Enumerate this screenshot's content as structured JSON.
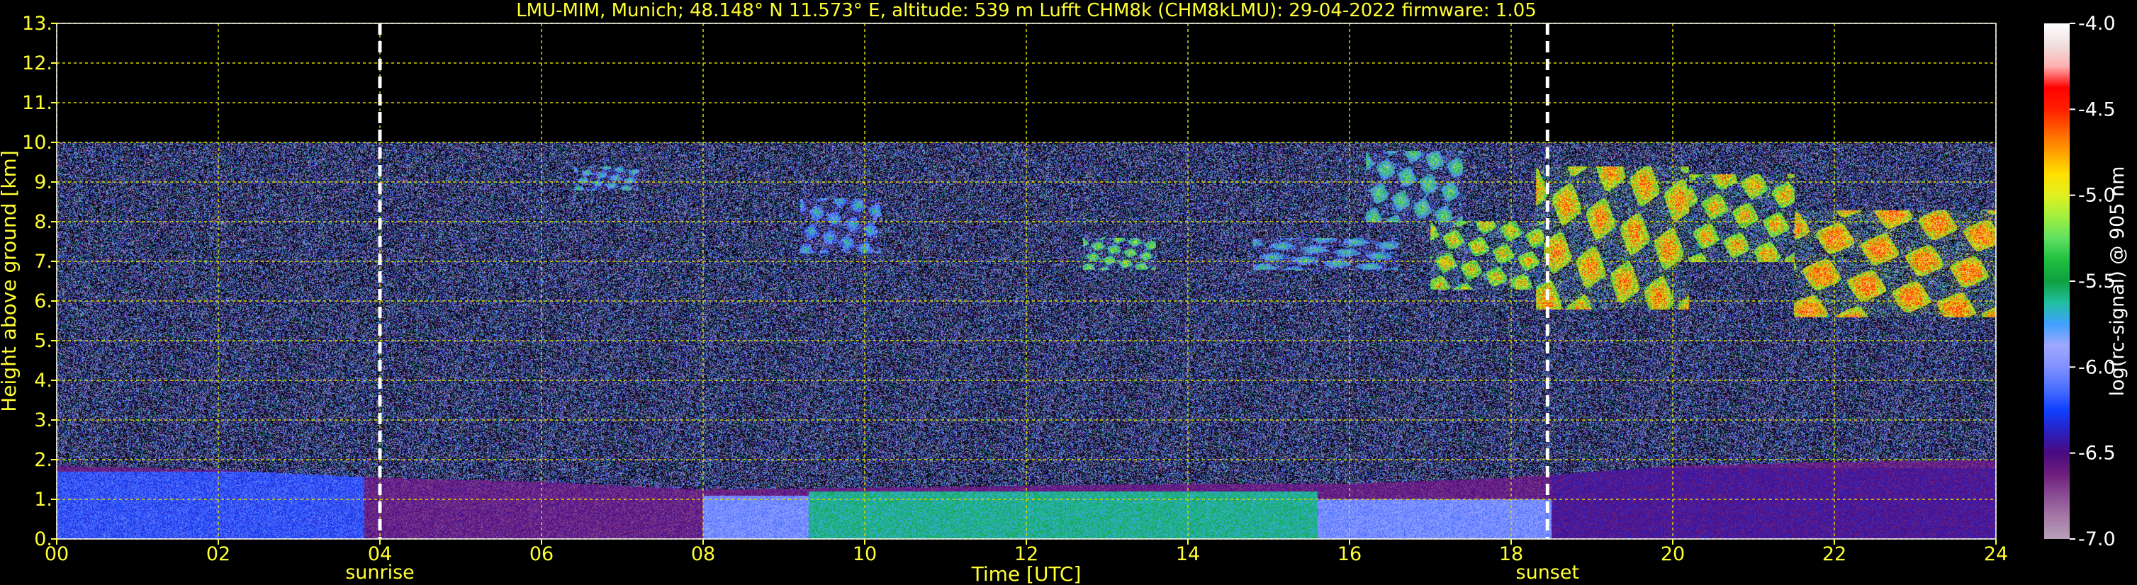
{
  "chart_data": {
    "type": "heatmap",
    "title": "LMU-MIM, Munich; 48.148° N 11.573° E, altitude: 539 m    Lufft CHM8k (CHM8kLMU): 29-04-2022    firmware: 1.05",
    "xlabel": "Time [UTC]",
    "ylabel": "Height above ground [km]",
    "xlim": [
      0,
      24
    ],
    "ylim": [
      0,
      13
    ],
    "x_ticks": [
      "00",
      "02",
      "04",
      "06",
      "08",
      "10",
      "12",
      "14",
      "16",
      "18",
      "20",
      "22",
      "24"
    ],
    "y_ticks": [
      "0.",
      "1.",
      "2.",
      "3.",
      "4.",
      "5.",
      "6.",
      "7.",
      "8.",
      "9.",
      "10.",
      "11.",
      "12.",
      "13."
    ],
    "grid": true,
    "colorbar": {
      "label": "log(rc-signal) @ 905 nm",
      "range": [
        -7.0,
        -4.0
      ],
      "ticks": [
        "-4.0",
        "-4.5",
        "-5.0",
        "-5.5",
        "-6.0",
        "-6.5",
        "-7.0"
      ],
      "colors": [
        "#b8a0b8",
        "#a77aa8",
        "#8a4e94",
        "#6e1f7e",
        "#4a0a80",
        "#2a20c0",
        "#1040ff",
        "#4a70ff",
        "#8090ff",
        "#a0a8ff",
        "#40a0ff",
        "#20c0a0",
        "#10a040",
        "#20c040",
        "#60e060",
        "#a0f040",
        "#e0f020",
        "#ffe000",
        "#ffa000",
        "#ff6000",
        "#ff2000",
        "#ff0000",
        "#ffb0b0",
        "#f0e0e0",
        "#ffffff"
      ]
    },
    "measurement_ceiling_km": 10,
    "events": [
      {
        "label": "sunrise",
        "time": 4.0
      },
      {
        "label": "sunset",
        "time": 18.45
      }
    ],
    "boundary_layer_top_km": [
      {
        "t": 0,
        "h": 1.85
      },
      {
        "t": 2,
        "h": 1.75
      },
      {
        "t": 4,
        "h": 1.55
      },
      {
        "t": 6,
        "h": 1.45
      },
      {
        "t": 8,
        "h": 1.25
      },
      {
        "t": 10,
        "h": 1.3
      },
      {
        "t": 12,
        "h": 1.35
      },
      {
        "t": 14,
        "h": 1.4
      },
      {
        "t": 16,
        "h": 1.4
      },
      {
        "t": 18,
        "h": 1.55
      },
      {
        "t": 20,
        "h": 1.85
      },
      {
        "t": 22,
        "h": 1.95
      },
      {
        "t": 24,
        "h": 2.0
      }
    ],
    "cloud_layers": [
      {
        "t_start": 6.4,
        "t_end": 7.2,
        "h_bottom": 8.8,
        "h_top": 9.4,
        "value": -5.6
      },
      {
        "t_start": 9.2,
        "t_end": 10.2,
        "h_bottom": 7.2,
        "h_top": 8.6,
        "value": -5.7
      },
      {
        "t_start": 12.7,
        "t_end": 13.6,
        "h_bottom": 6.8,
        "h_top": 7.6,
        "value": -5.2
      },
      {
        "t_start": 14.8,
        "t_end": 16.6,
        "h_bottom": 6.8,
        "h_top": 7.6,
        "value": -5.6
      },
      {
        "t_start": 16.2,
        "t_end": 17.4,
        "h_bottom": 8.0,
        "h_top": 9.8,
        "value": -5.4
      },
      {
        "t_start": 17.0,
        "t_end": 18.4,
        "h_bottom": 6.3,
        "h_top": 8.0,
        "value": -4.9
      },
      {
        "t_start": 18.3,
        "t_end": 20.2,
        "h_bottom": 5.8,
        "h_top": 9.4,
        "value": -4.7
      },
      {
        "t_start": 19.8,
        "t_end": 21.5,
        "h_bottom": 7.0,
        "h_top": 9.2,
        "value": -4.8
      },
      {
        "t_start": 21.5,
        "t_end": 24.0,
        "h_bottom": 5.6,
        "h_top": 8.3,
        "value": -4.6
      }
    ],
    "boundary_layer_bands": [
      {
        "t_start": 0,
        "t_end": 3.8,
        "h_bottom": 0,
        "h_top": 1.7,
        "value": -6.2
      },
      {
        "t_start": 3.8,
        "t_end": 8.0,
        "h_bottom": 0,
        "h_top": 1.5,
        "value": -6.6
      },
      {
        "t_start": 8.0,
        "t_end": 9.3,
        "h_bottom": 0,
        "h_top": 1.1,
        "value": -6.0
      },
      {
        "t_start": 9.3,
        "t_end": 15.6,
        "h_bottom": 0,
        "h_top": 1.2,
        "value": -5.6
      },
      {
        "t_start": 15.6,
        "t_end": 18.5,
        "h_bottom": 0,
        "h_top": 1.0,
        "value": -6.0
      },
      {
        "t_start": 18.5,
        "t_end": 24.0,
        "h_bottom": 0,
        "h_top": 1.8,
        "value": -6.5
      }
    ]
  }
}
